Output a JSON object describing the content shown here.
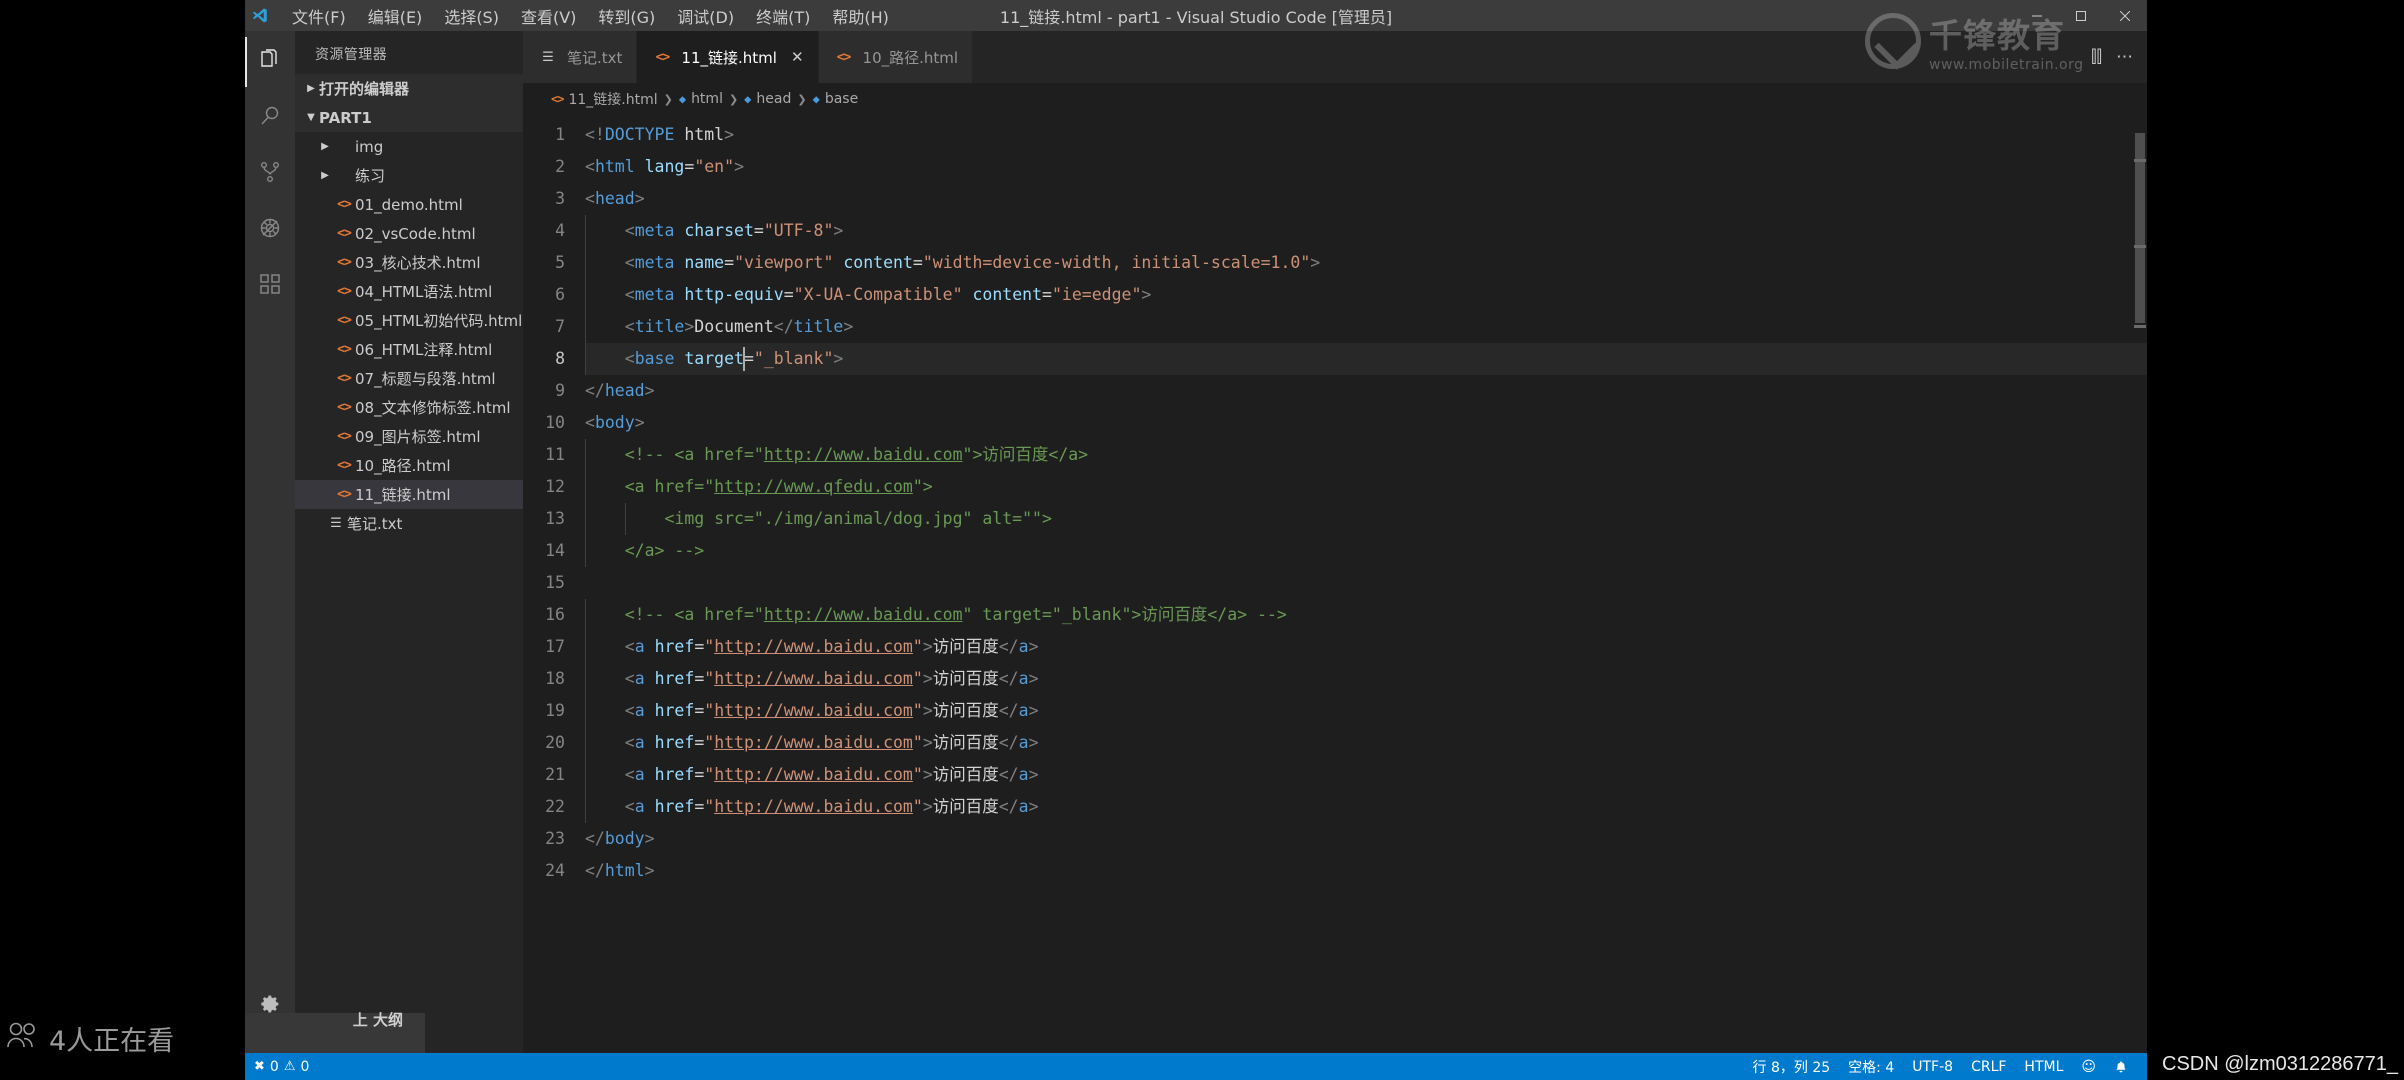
{
  "window": {
    "title": "11_链接.html - part1 - Visual Studio Code [管理员]",
    "minimize_label": "—",
    "maximize_label": "▢",
    "close_label": "✕"
  },
  "menubar": {
    "items": [
      {
        "label": "文件(F)"
      },
      {
        "label": "编辑(E)"
      },
      {
        "label": "选择(S)"
      },
      {
        "label": "查看(V)"
      },
      {
        "label": "转到(G)"
      },
      {
        "label": "调试(D)"
      },
      {
        "label": "终端(T)"
      },
      {
        "label": "帮助(H)"
      }
    ]
  },
  "activitybar": {
    "items": [
      {
        "name": "explorer-icon",
        "title": "资源管理器",
        "active": true
      },
      {
        "name": "search-icon",
        "title": "搜索",
        "active": false
      },
      {
        "name": "source-control-icon",
        "title": "源代码管理",
        "active": false
      },
      {
        "name": "debug-icon",
        "title": "调试",
        "active": false
      },
      {
        "name": "extensions-icon",
        "title": "扩展",
        "active": false
      }
    ],
    "settings": {
      "name": "gear-icon",
      "title": "管理"
    }
  },
  "sidebar": {
    "title": "资源管理器",
    "sections": [
      {
        "label": "打开的编辑器",
        "expanded": false
      },
      {
        "label": "PART1",
        "expanded": true
      }
    ],
    "tree": [
      {
        "label": "img",
        "type": "folder",
        "depth": 1,
        "selected": false
      },
      {
        "label": "练习",
        "type": "folder",
        "depth": 1,
        "selected": false
      },
      {
        "label": "01_demo.html",
        "type": "html",
        "depth": 1,
        "selected": false
      },
      {
        "label": "02_vsCode.html",
        "type": "html",
        "depth": 1,
        "selected": false
      },
      {
        "label": "03_核心技术.html",
        "type": "html",
        "depth": 1,
        "selected": false
      },
      {
        "label": "04_HTML语法.html",
        "type": "html",
        "depth": 1,
        "selected": false
      },
      {
        "label": "05_HTML初始代码.html",
        "type": "html",
        "depth": 1,
        "selected": false
      },
      {
        "label": "06_HTML注释.html",
        "type": "html",
        "depth": 1,
        "selected": false
      },
      {
        "label": "07_标题与段落.html",
        "type": "html",
        "depth": 1,
        "selected": false
      },
      {
        "label": "08_文本修饰标签.html",
        "type": "html",
        "depth": 1,
        "selected": false
      },
      {
        "label": "09_图片标签.html",
        "type": "html",
        "depth": 1,
        "selected": false
      },
      {
        "label": "10_路径.html",
        "type": "html",
        "depth": 1,
        "selected": false
      },
      {
        "label": "11_链接.html",
        "type": "html",
        "depth": 1,
        "selected": true
      },
      {
        "label": "笔记.txt",
        "type": "txt",
        "depth": 1,
        "selected": false
      }
    ]
  },
  "tabs": [
    {
      "label": "笔记.txt",
      "type": "txt",
      "active": false,
      "closable": false
    },
    {
      "label": "11_链接.html",
      "type": "html",
      "active": true,
      "closable": true,
      "close": "✕"
    },
    {
      "label": "10_路径.html",
      "type": "html",
      "active": false,
      "closable": false
    }
  ],
  "tab_actions": {
    "split_label": "⫿⫿",
    "more_label": "⋯"
  },
  "breadcrumb": [
    {
      "label": "11_链接.html",
      "icon": "html-file-icon"
    },
    {
      "label": "html",
      "icon": "tag-icon"
    },
    {
      "label": "head",
      "icon": "tag-icon"
    },
    {
      "label": "base",
      "icon": "tag-icon"
    }
  ],
  "editor": {
    "language": "HTML",
    "current_line": 8,
    "lines": [
      {
        "n": 1,
        "indent": 0,
        "html": "<span class='punct'>&lt;!</span><span class='tag'>DOCTYPE</span> <span class='plain'>html</span><span class='punct'>&gt;</span>",
        "text": "<!DOCTYPE html>"
      },
      {
        "n": 2,
        "indent": 0,
        "html": "<span class='punct'>&lt;</span><span class='tag'>html</span> <span class='attr'>lang</span><span class='plain'>=</span><span class='str'>\"en\"</span><span class='punct'>&gt;</span>",
        "text": "<html lang=\"en\">"
      },
      {
        "n": 3,
        "indent": 0,
        "html": "<span class='punct'>&lt;</span><span class='tag'>head</span><span class='punct'>&gt;</span>",
        "text": "<head>"
      },
      {
        "n": 4,
        "indent": 1,
        "html": "    <span class='punct'>&lt;</span><span class='tag'>meta</span> <span class='attr'>charset</span><span class='plain'>=</span><span class='str'>\"UTF-8\"</span><span class='punct'>&gt;</span>",
        "text": "    <meta charset=\"UTF-8\">"
      },
      {
        "n": 5,
        "indent": 1,
        "html": "    <span class='punct'>&lt;</span><span class='tag'>meta</span> <span class='attr'>name</span><span class='plain'>=</span><span class='str'>\"viewport\"</span> <span class='attr'>content</span><span class='plain'>=</span><span class='str'>\"width=device-width, initial-scale=1.0\"</span><span class='punct'>&gt;</span>",
        "text": "    <meta name=\"viewport\" content=\"width=device-width, initial-scale=1.0\">"
      },
      {
        "n": 6,
        "indent": 1,
        "html": "    <span class='punct'>&lt;</span><span class='tag'>meta</span> <span class='attr'>http-equiv</span><span class='plain'>=</span><span class='str'>\"X-UA-Compatible\"</span> <span class='attr'>content</span><span class='plain'>=</span><span class='str'>\"ie=edge\"</span><span class='punct'>&gt;</span>",
        "text": "    <meta http-equiv=\"X-UA-Compatible\" content=\"ie=edge\">"
      },
      {
        "n": 7,
        "indent": 1,
        "html": "    <span class='punct'>&lt;</span><span class='tag'>title</span><span class='punct'>&gt;</span><span class='plain'>Document</span><span class='punct'>&lt;/</span><span class='tag'>title</span><span class='punct'>&gt;</span>",
        "text": "    <title>Document</title>"
      },
      {
        "n": 8,
        "indent": 1,
        "html": "    <span class='punct'>&lt;</span><span class='tag'>base</span> <span class='attr'>target</span><span class='plain'>=</span><span class='str'>\"_blank\"</span><span class='punct'>&gt;</span>",
        "text": "    <base target=\"_blank\">"
      },
      {
        "n": 9,
        "indent": 0,
        "html": "<span class='punct'>&lt;/</span><span class='tag'>head</span><span class='punct'>&gt;</span>",
        "text": "</head>"
      },
      {
        "n": 10,
        "indent": 0,
        "html": "<span class='punct'>&lt;</span><span class='tag'>body</span><span class='punct'>&gt;</span>",
        "text": "<body>"
      },
      {
        "n": 11,
        "indent": 1,
        "html": "    <span class='comment'>&lt;!-- &lt;a href=\"<span class='lnkc'>http://www.baidu.com</span>\"&gt;访问百度&lt;/a&gt;</span>",
        "text": "    <!-- <a href=\"http://www.baidu.com\">访问百度</a>"
      },
      {
        "n": 12,
        "indent": 1,
        "html": "    <span class='comment'>&lt;a href=\"<span class='lnkc'>http://www.qfedu.com</span>\"&gt;</span>",
        "text": "    <a href=\"http://www.qfedu.com\">"
      },
      {
        "n": 13,
        "indent": 2,
        "html": "        <span class='comment'>&lt;img src=\"./img/animal/dog.jpg\" alt=\"\"&gt;</span>",
        "text": "        <img src=\"./img/animal/dog.jpg\" alt=\"\">"
      },
      {
        "n": 14,
        "indent": 1,
        "html": "    <span class='comment'>&lt;/a&gt; --&gt;</span>",
        "text": "    </a> -->"
      },
      {
        "n": 15,
        "indent": 0,
        "html": "",
        "text": ""
      },
      {
        "n": 16,
        "indent": 1,
        "html": "    <span class='comment'>&lt;!-- &lt;a href=\"<span class='lnkc'>http://www.baidu.com</span>\" target=\"_blank\"&gt;访问百度&lt;/a&gt; --&gt;</span>",
        "text": "    <!-- <a href=\"http://www.baidu.com\" target=\"_blank\">访问百度</a> -->"
      },
      {
        "n": 17,
        "indent": 1,
        "html": "    <span class='punct'>&lt;</span><span class='tag'>a</span> <span class='attr'>href</span><span class='plain'>=</span><span class='str'>\"<span class='lnk'>http://www.baidu.com</span>\"</span><span class='punct'>&gt;</span><span class='plain'>访问百度</span><span class='punct'>&lt;/</span><span class='tag'>a</span><span class='punct'>&gt;</span>",
        "text": "    <a href=\"http://www.baidu.com\">访问百度</a>"
      },
      {
        "n": 18,
        "indent": 1,
        "html": "    <span class='punct'>&lt;</span><span class='tag'>a</span> <span class='attr'>href</span><span class='plain'>=</span><span class='str'>\"<span class='lnk'>http://www.baidu.com</span>\"</span><span class='punct'>&gt;</span><span class='plain'>访问百度</span><span class='punct'>&lt;/</span><span class='tag'>a</span><span class='punct'>&gt;</span>",
        "text": "    <a href=\"http://www.baidu.com\">访问百度</a>"
      },
      {
        "n": 19,
        "indent": 1,
        "html": "    <span class='punct'>&lt;</span><span class='tag'>a</span> <span class='attr'>href</span><span class='plain'>=</span><span class='str'>\"<span class='lnk'>http://www.baidu.com</span>\"</span><span class='punct'>&gt;</span><span class='plain'>访问百度</span><span class='punct'>&lt;/</span><span class='tag'>a</span><span class='punct'>&gt;</span>",
        "text": "    <a href=\"http://www.baidu.com\">访问百度</a>"
      },
      {
        "n": 20,
        "indent": 1,
        "html": "    <span class='punct'>&lt;</span><span class='tag'>a</span> <span class='attr'>href</span><span class='plain'>=</span><span class='str'>\"<span class='lnk'>http://www.baidu.com</span>\"</span><span class='punct'>&gt;</span><span class='plain'>访问百度</span><span class='punct'>&lt;/</span><span class='tag'>a</span><span class='punct'>&gt;</span>",
        "text": "    <a href=\"http://www.baidu.com\">访问百度</a>"
      },
      {
        "n": 21,
        "indent": 1,
        "html": "    <span class='punct'>&lt;</span><span class='tag'>a</span> <span class='attr'>href</span><span class='plain'>=</span><span class='str'>\"<span class='lnk'>http://www.baidu.com</span>\"</span><span class='punct'>&gt;</span><span class='plain'>访问百度</span><span class='punct'>&lt;/</span><span class='tag'>a</span><span class='punct'>&gt;</span>",
        "text": "    <a href=\"http://www.baidu.com\">访问百度</a>"
      },
      {
        "n": 22,
        "indent": 1,
        "html": "    <span class='punct'>&lt;</span><span class='tag'>a</span> <span class='attr'>href</span><span class='plain'>=</span><span class='str'>\"<span class='lnk'>http://www.baidu.com</span>\"</span><span class='punct'>&gt;</span><span class='plain'>访问百度</span><span class='punct'>&lt;/</span><span class='tag'>a</span><span class='punct'>&gt;</span>",
        "text": "    <a href=\"http://www.baidu.com\">访问百度</a>"
      },
      {
        "n": 23,
        "indent": 0,
        "html": "<span class='punct'>&lt;/</span><span class='tag'>body</span><span class='punct'>&gt;</span>",
        "text": "</body>"
      },
      {
        "n": 24,
        "indent": 0,
        "html": "<span class='punct'>&lt;/</span><span class='tag'>html</span><span class='punct'>&gt;</span>",
        "text": "</html>"
      }
    ]
  },
  "statusbar": {
    "errors": "0",
    "warnings": "0",
    "error_icon": "✖",
    "warning_icon": "⚠",
    "position": "行 8，列 25",
    "indentation": "空格: 4",
    "encoding": "UTF-8",
    "eol": "CRLF",
    "language": "HTML",
    "feedback_icon": "☺",
    "bell_icon": "🔔"
  },
  "overlays": {
    "viewers": "4人正在看",
    "viewers_icon": "people-icon",
    "tooltip": "上 大纲",
    "watermark_brand": "千锋教育",
    "watermark_url": "www.mobiletrain.org",
    "csdn": "CSDN @lzm0312286771_"
  }
}
